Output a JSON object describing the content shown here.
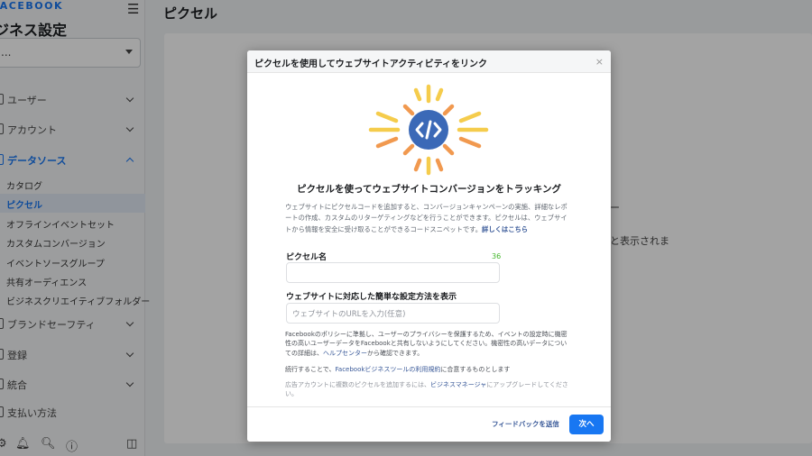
{
  "sidebar": {
    "brand": "FACEBOOK",
    "title": "ジネス設定",
    "account_select": {
      "value": "..."
    },
    "nav": [
      {
        "label": "ユーザー"
      },
      {
        "label": "アカウント"
      },
      {
        "label": "データソース"
      },
      {
        "label": "ブランドセーフティ"
      },
      {
        "label": "登録"
      },
      {
        "label": "統合"
      },
      {
        "label": "支払い方法"
      }
    ],
    "data_sources": [
      {
        "label": "カタログ"
      },
      {
        "label": "ピクセル"
      },
      {
        "label": "オフラインイベントセット"
      },
      {
        "label": "カスタムコンバージョン"
      },
      {
        "label": "イベントソースグループ"
      },
      {
        "label": "共有オーディエンス"
      },
      {
        "label": "ビジネスクリエイティブフォルダー"
      }
    ]
  },
  "main": {
    "title": "ピクセル",
    "bg_text_1": "ー",
    "bg_text_2": "と表示されま"
  },
  "dialog": {
    "title": "ピクセルを使用してウェブサイトアクティビティをリンク",
    "close": "×",
    "hero_title": "ピクセルを使ってウェブサイトコンバージョンをトラッキング",
    "intro": "ウェブサイトにピクセルコードを追加すると、コンバージョンキャンペーンの実施、詳細なレポートの作成、カスタムのリターゲティングなどを行うことができます。ピクセルは、ウェブサイトから情報を安全に受け取ることができるコードスニペットです。",
    "intro_link": "詳しくはこちら",
    "pixel_name_label": "ピクセル名",
    "pixel_name_counter": "36",
    "pixel_name_value": "",
    "setup_label": "ウェブサイトに対応した簡単な設定方法を表示",
    "url_placeholder": "ウェブサイトのURLを入力(任意)",
    "policy": "Facebookのポリシーに準拠し、ユーザーのプライバシーを保護するため、イベントの設定時に機密性の高いユーザーデータをFacebookと共有しないようにしてください。機密性の高いデータについての詳細は、",
    "policy_link": "ヘルプセンター",
    "policy_tail": "から確認できます。",
    "continue_prefix": "続行することで、",
    "continue_link": "Facebookビジネスツールの利用規約",
    "continue_suffix": "に合意するものとします",
    "upgrade_prefix": "広告アカウントに複数のピクセルを追加するには、",
    "upgrade_link": "ビジネスマネージャ",
    "upgrade_suffix": "にアップグレードしてください。",
    "feedback": "フィードバックを送信",
    "next": "次へ"
  },
  "colors": {
    "accent": "#1877f2",
    "icon_circle": "#3b69b7",
    "sun_yellow": "#f5cc4c",
    "sun_orange": "#f1994f"
  }
}
